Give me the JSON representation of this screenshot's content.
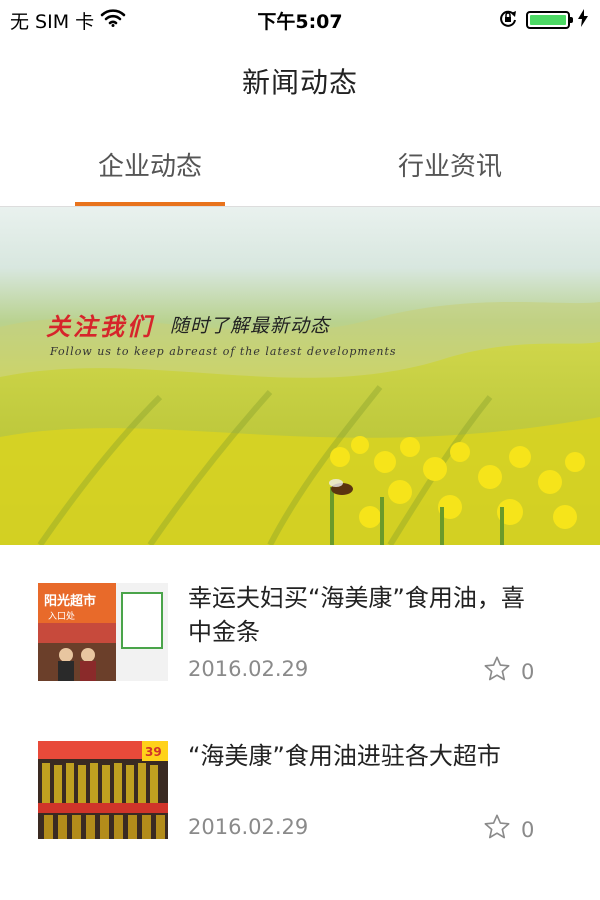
{
  "status_bar": {
    "carrier": "无 SIM 卡",
    "time": "下午5:07",
    "battery_level": 1.0
  },
  "header": {
    "title": "新闻动态"
  },
  "tabs": [
    {
      "label": "企业动态",
      "active": true
    },
    {
      "label": "行业资讯",
      "active": false
    }
  ],
  "banner": {
    "title": "关注我们",
    "subtitle": "随时了解最新动态",
    "english": "Follow us to keep abreast of the latest developments"
  },
  "news": [
    {
      "title": " 幸运夫妇买“海美康”食用油，喜中金条",
      "date": "2016.02.29",
      "likes": "0",
      "thumb_text": "阳光超市",
      "thumb_sub": "入口处"
    },
    {
      "title": "“海美康”食用油进驻各大超市",
      "date": "2016.02.29",
      "likes": "0",
      "thumb_text": "39"
    }
  ],
  "colors": {
    "accent": "#e8731c",
    "meta_gray": "#8a8a8a",
    "battery_green": "#4cd964"
  },
  "icons": [
    "wifi-icon",
    "rotation-lock-icon",
    "battery-icon",
    "charging-icon",
    "star-icon"
  ]
}
